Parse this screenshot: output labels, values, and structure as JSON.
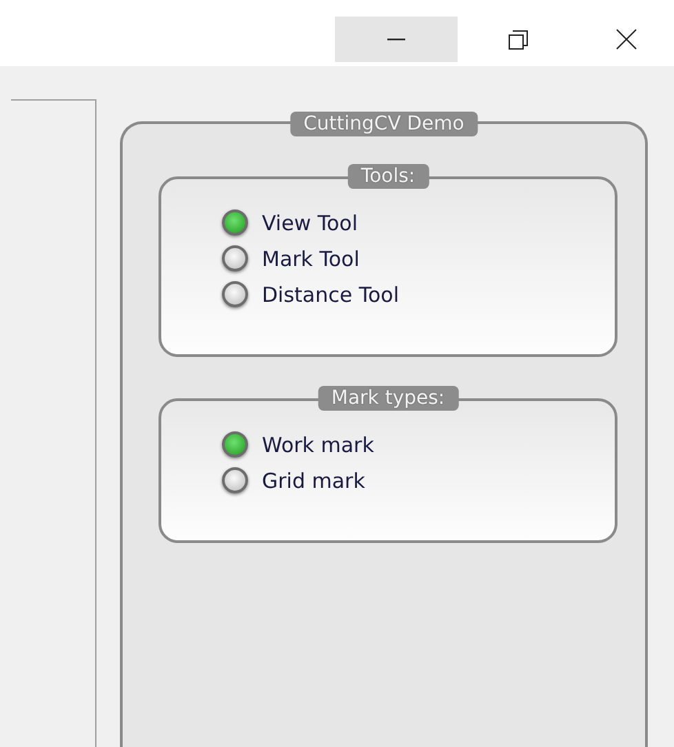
{
  "window": {
    "controls": [
      {
        "kind": "minimize",
        "hovered": true
      },
      {
        "kind": "restore",
        "hovered": false
      },
      {
        "kind": "close",
        "hovered": false
      }
    ]
  },
  "panel": {
    "title": "CuttingCV Demo",
    "groups": [
      {
        "title": "Tools:",
        "options": [
          {
            "label": "View Tool",
            "selected": true
          },
          {
            "label": "Mark Tool",
            "selected": false
          },
          {
            "label": "Distance Tool",
            "selected": false
          }
        ]
      },
      {
        "title": "Mark types:",
        "options": [
          {
            "label": "Work mark",
            "selected": true
          },
          {
            "label": "Grid mark",
            "selected": false
          }
        ]
      }
    ]
  }
}
